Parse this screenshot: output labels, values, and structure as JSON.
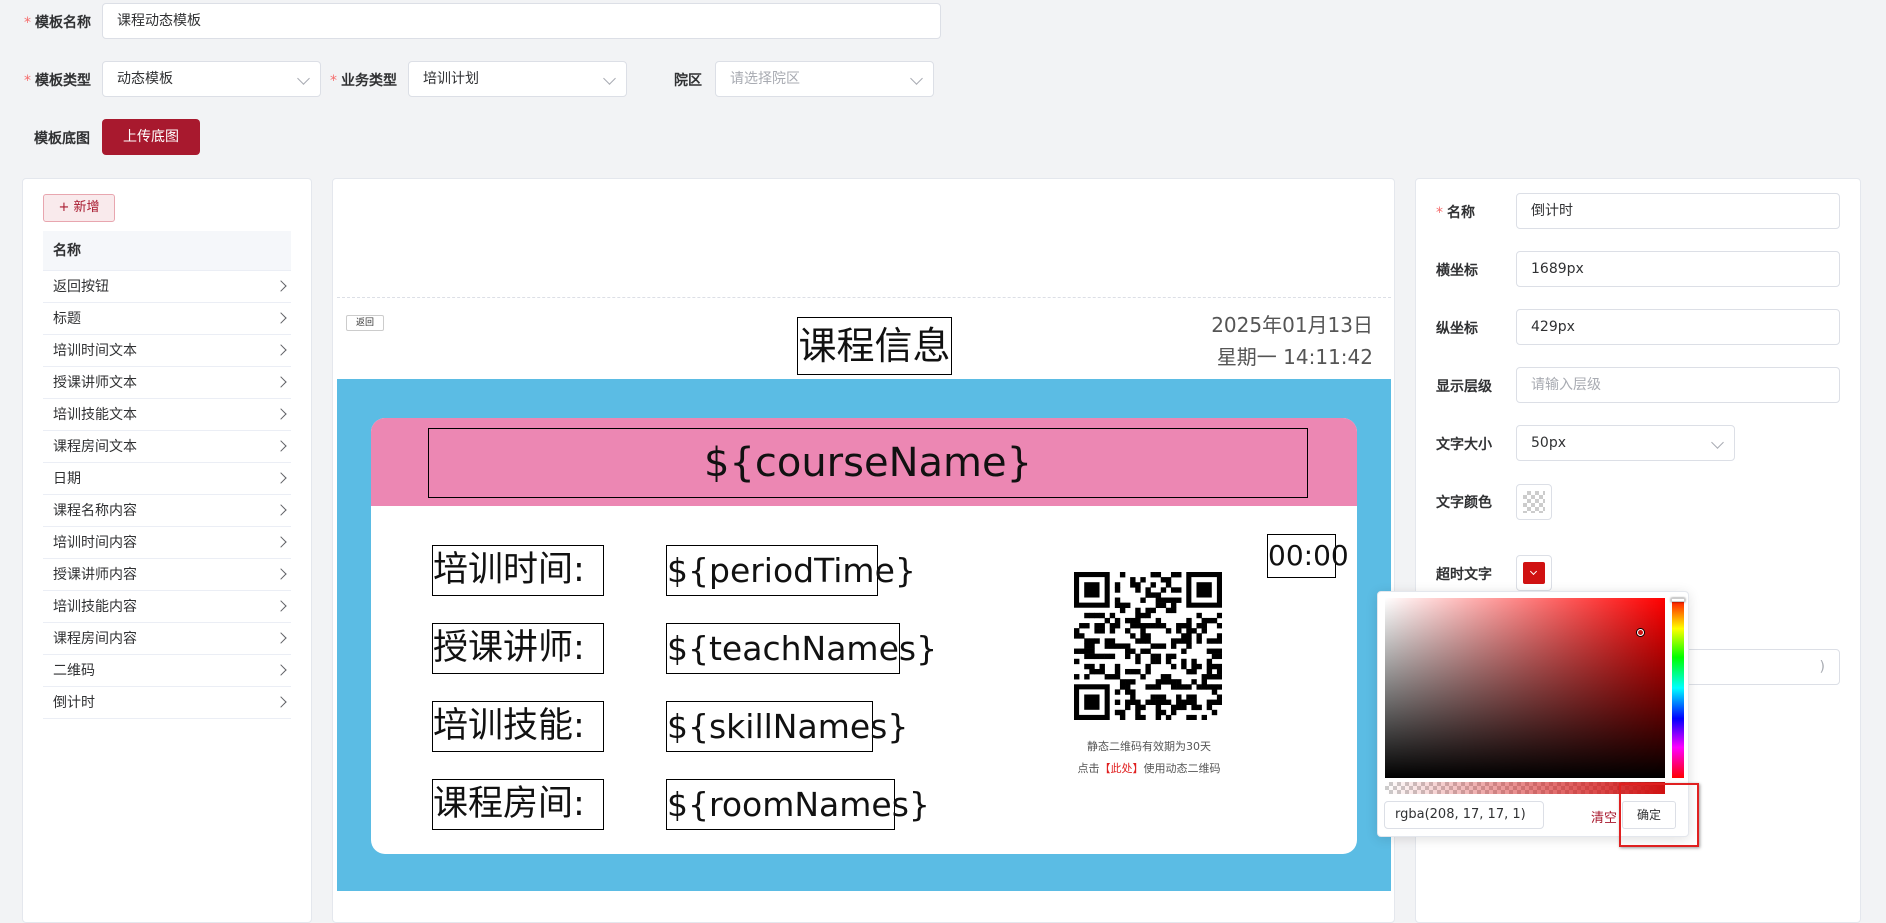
{
  "form": {
    "template_name_label": "模板名称",
    "template_name_value": "课程动态模板",
    "template_type_label": "模板类型",
    "template_type_value": "动态模板",
    "business_type_label": "业务类型",
    "business_type_value": "培训计划",
    "campus_label": "院区",
    "campus_placeholder": "请选择院区",
    "bg_label": "模板底图",
    "upload_button": "上传底图"
  },
  "left_panel": {
    "add_button": "+ 新增",
    "header": "名称",
    "items": [
      "返回按钮",
      "标题",
      "培训时间文本",
      "授课讲师文本",
      "培训技能文本",
      "课程房间文本",
      "日期",
      "课程名称内容",
      "培训时间内容",
      "授课讲师内容",
      "培训技能内容",
      "课程房间内容",
      "二维码",
      "倒计时"
    ]
  },
  "canvas": {
    "back_button": "返回",
    "title": "课程信息",
    "date_line1": "2025年01月13日",
    "date_line2": "星期一 14:11:42",
    "course_name": "${courseName}",
    "countdown": "00:00",
    "labels": [
      "培训时间:",
      "授课讲师:",
      "培训技能:",
      "课程房间:"
    ],
    "values": [
      "${periodTime}",
      "${teachNames}",
      "${skillNames}",
      "${roomNames}"
    ],
    "qr_note1": "静态二维码有效期为30天",
    "qr_note2_prefix": "点击",
    "qr_note2_link": "【此处】",
    "qr_note2_suffix": "使用动态二维码"
  },
  "right_panel": {
    "name_label": "名称",
    "name_value": "倒计时",
    "x_label": "横坐标",
    "x_value": "1689px",
    "y_label": "纵坐标",
    "y_value": "429px",
    "z_label": "显示层级",
    "z_placeholder": "请输入层级",
    "font_size_label": "文字大小",
    "font_size_value": "50px",
    "font_color_label": "文字颜色",
    "timeout_label": "超时文字",
    "hidden_input_suffix": ")"
  },
  "color_picker": {
    "value": "rgba(208, 17, 17, 1)",
    "clear_button": "清空",
    "confirm_button": "确定",
    "current_color": "#d01111"
  },
  "colors": {
    "primary": "#a8192e",
    "canvas_bg": "#5bbce4",
    "header_band": "#ec87b3",
    "highlight": "#e02020"
  }
}
